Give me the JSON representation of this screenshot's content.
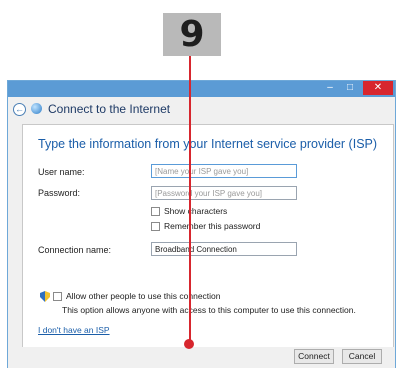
{
  "callout": {
    "step": "9"
  },
  "window": {
    "title": "Connect to the Internet",
    "minimize_glyph": "–",
    "maximize_glyph": "□",
    "close_glyph": "✕",
    "back_glyph": "←"
  },
  "form": {
    "heading": "Type the information from your Internet service provider (ISP)",
    "username": {
      "label": "User name:",
      "placeholder": "[Name your ISP gave you]"
    },
    "password": {
      "label": "Password:",
      "placeholder": "[Password your ISP gave you]"
    },
    "show_characters": {
      "label": "Show characters",
      "checked": false
    },
    "remember_password": {
      "label": "Remember this password",
      "checked": false
    },
    "connection_name": {
      "label": "Connection name:",
      "value": "Broadband Connection"
    },
    "allow_others": {
      "label": "Allow other people to use this connection",
      "note": "This option allows anyone with access to this computer to use this connection.",
      "checked": false
    },
    "no_isp_link": "I don't have an ISP"
  },
  "footer": {
    "connect_label": "Connect",
    "cancel_label": "Cancel"
  },
  "icons": [
    "back-arrow-icon",
    "globe-icon",
    "shield-icon"
  ],
  "colors": {
    "accent": "#5b9bd5",
    "heading": "#1b5ea9",
    "callout_line": "#d7262e"
  }
}
